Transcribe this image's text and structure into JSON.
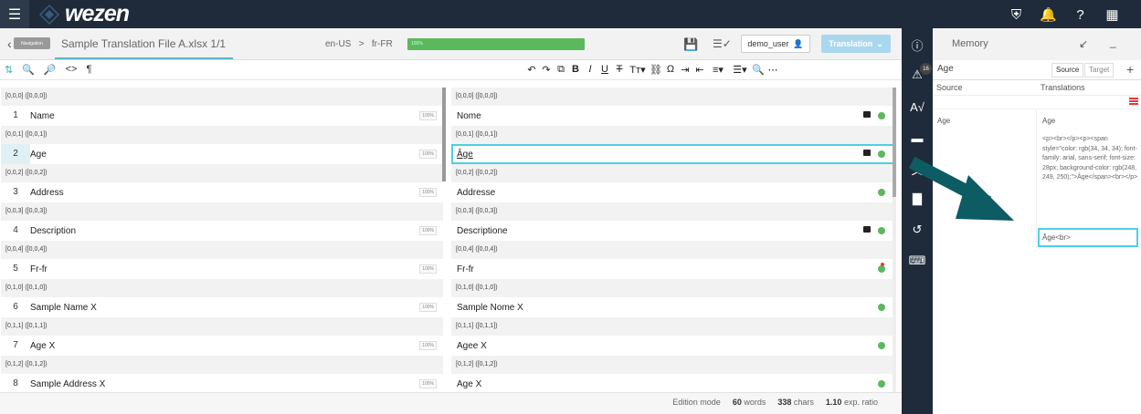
{
  "app": {
    "name": "wezen",
    "menu_icon": "hamburger-icon",
    "top_icons": [
      "shield-icon",
      "bell-icon",
      "help-icon",
      "grid-icon"
    ]
  },
  "file": {
    "nav_label": "Navigation",
    "title": "Sample Translation File A.xlsx 1/1",
    "source_lang": "en-US",
    "arrow": ">",
    "target_lang": "fr-FR",
    "progress": 1.0,
    "progress_label": "100%",
    "user": "demo_user",
    "mode_button": "Translation"
  },
  "toolbar": {
    "left_icons": [
      "arrows-icon",
      "zoom-in-icon",
      "zoom-out-icon",
      "code-icon",
      "pilcrow-icon"
    ],
    "right_icons": [
      "undo-icon",
      "redo-icon",
      "copy-icon",
      "bold-icon",
      "italic-icon",
      "underline-icon",
      "strike-icon",
      "font-size-icon",
      "link-icon",
      "omega-icon",
      "indent-icon",
      "outdent-icon",
      "list-icon",
      "align-icon",
      "search-icon",
      "more-icon"
    ]
  },
  "segments": [
    {
      "ref": "[0,0,0] ([0,0,0])",
      "num": "1",
      "source": "Name",
      "pct": "100%",
      "target": "Nome",
      "comment": true,
      "status": "green"
    },
    {
      "ref": "[0,0,1] ([0,0,1])",
      "num": "2",
      "source": "Age",
      "pct": "100%",
      "target": "Âge",
      "comment": true,
      "status": "green",
      "active": true
    },
    {
      "ref": "[0,0,2] ([0,0,2])",
      "num": "3",
      "source": "Address",
      "pct": "100%",
      "target": "Addresse",
      "comment": false,
      "status": "green"
    },
    {
      "ref": "[0,0,3] ([0,0,3])",
      "num": "4",
      "source": "Description",
      "pct": "100%",
      "target": "Descriptione",
      "comment": true,
      "status": "green"
    },
    {
      "ref": "[0,0,4] ([0,0,4])",
      "num": "5",
      "source": "Fr-fr",
      "pct": "100%",
      "target": "Fr-fr",
      "comment": false,
      "status": "green-flag"
    },
    {
      "ref": "[0,1,0] ([0,1,0])",
      "num": "6",
      "source": "Sample Name X",
      "pct": "100%",
      "target": "Sample Nome X",
      "comment": false,
      "status": "green"
    },
    {
      "ref": "[0,1,1] ([0,1,1])",
      "num": "7",
      "source": "Age X",
      "pct": "100%",
      "target": "Agee X",
      "comment": false,
      "status": "green"
    },
    {
      "ref": "[0,1,2] ([0,1,2])",
      "num": "8",
      "source": "Sample Address X",
      "pct": "100%",
      "target": "Age X",
      "comment": false,
      "status": "green"
    }
  ],
  "status": {
    "mode": "Edition mode",
    "words_num": "60",
    "words_label": "words",
    "chars_num": "338",
    "chars_label": "chars",
    "ratio_num": "1.10",
    "ratio_label": "exp. ratio"
  },
  "rail": {
    "badge": "16",
    "icons": [
      "info-icon",
      "warning-icon",
      "spellcheck-icon",
      "glossary-icon",
      "translate-icon",
      "comment-icon",
      "history-icon",
      "keyboard-icon"
    ]
  },
  "memory": {
    "title": "Memory",
    "search_value": "Age",
    "source_btn": "Source",
    "target_btn": "Target",
    "plus": "+",
    "col_source": "Source",
    "col_translations": "Translations",
    "entry_source": "Age",
    "entry_target": "Age",
    "entry_html": "<p><br></p><p><span style=\"color: rgb(34, 34, 34); font-family: arial, sans-serif; font-size: 28px; background-color: rgb(248, 249, 250);\">Âge</span><br></p>",
    "entry_edit": "Âge<br>"
  },
  "colors": {
    "accent": "#4dd0e1",
    "topbar": "#1f2b3a",
    "progress": "#5cb85c",
    "arrow": "#0d5b63"
  }
}
